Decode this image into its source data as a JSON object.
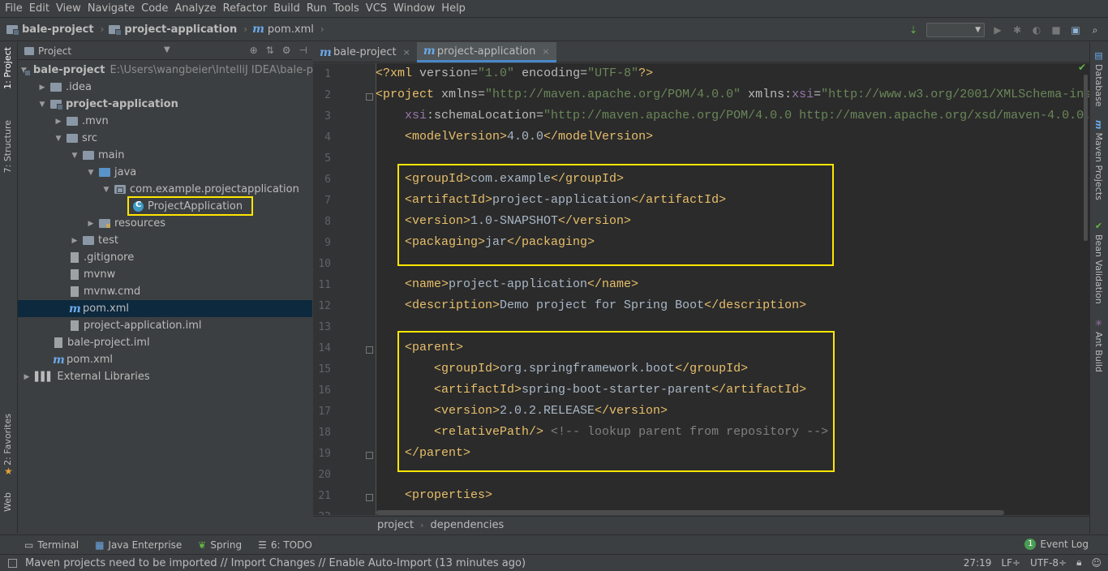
{
  "menu": [
    "File",
    "Edit",
    "View",
    "Navigate",
    "Code",
    "Analyze",
    "Refactor",
    "Build",
    "Run",
    "Tools",
    "VCS",
    "Window",
    "Help"
  ],
  "navbar": {
    "crumbs": [
      "bale-project",
      "project-application",
      "pom.xml"
    ]
  },
  "left_tabs": {
    "project": "1: Project",
    "structure": "7: Structure",
    "favorites": "2: Favorites",
    "web": "Web"
  },
  "right_tabs": {
    "database": "Database",
    "maven": "Maven Projects",
    "bean": "Bean Validation",
    "ant": "Ant Build"
  },
  "project_panel": {
    "title": "Project",
    "tree": [
      {
        "label": "bale-project",
        "path": "E:\\Users\\wangbeier\\IntelliJ IDEA\\bale-pro"
      },
      {
        "label": ".idea"
      },
      {
        "label": "project-application"
      },
      {
        "label": ".mvn"
      },
      {
        "label": "src"
      },
      {
        "label": "main"
      },
      {
        "label": "java"
      },
      {
        "label": "com.example.projectapplication"
      },
      {
        "label": "ProjectApplication"
      },
      {
        "label": "resources"
      },
      {
        "label": "test"
      },
      {
        "label": ".gitignore"
      },
      {
        "label": "mvnw"
      },
      {
        "label": "mvnw.cmd"
      },
      {
        "label": "pom.xml"
      },
      {
        "label": "project-application.iml"
      },
      {
        "label": "bale-project.iml"
      },
      {
        "label": "pom.xml"
      },
      {
        "label": "External Libraries"
      }
    ]
  },
  "editor_tabs": [
    {
      "label": "bale-project",
      "active": false
    },
    {
      "label": "project-application",
      "active": true
    }
  ],
  "editor": {
    "line_numbers": [
      "1",
      "2",
      "3",
      "4",
      "5",
      "6",
      "7",
      "8",
      "9",
      "10",
      "11",
      "12",
      "13",
      "14",
      "15",
      "16",
      "17",
      "18",
      "19",
      "20",
      "21",
      "22"
    ],
    "lines": [
      {
        "xml_decl": "<?xml",
        "v_attr": "version=",
        "v_val": "\"1.0\"",
        "e_attr": "encoding=",
        "e_val": "\"UTF-8\"",
        "end": "?>"
      },
      {
        "tag": "<project",
        "a1": "xmlns=",
        "v1": "\"http://maven.apache.org/POM/4.0.0\"",
        "a2": "xmlns:",
        "ns": "xsi",
        "a3": "=",
        "v2": "\"http://www.w3.org/2001/XMLSchema-ins"
      },
      {
        "ns": "xsi",
        "a": ":schemaLocation=",
        "v": "\"http://maven.apache.org/POM/4.0.0 http://maven.apache.org/xsd/maven-4.0.0."
      },
      {
        "open": "<modelVersion>",
        "text": "4.0.0",
        "close": "</modelVersion>"
      },
      {},
      {
        "open": "<groupId>",
        "text": "com.example",
        "close": "</groupId>"
      },
      {
        "open": "<artifactId>",
        "text": "project-application",
        "close": "</artifactId>"
      },
      {
        "open": "<version>",
        "text": "1.0-SNAPSHOT",
        "close": "</version>"
      },
      {
        "open": "<packaging>",
        "text": "jar",
        "close": "</packaging>"
      },
      {},
      {
        "open": "<name>",
        "text": "project-application",
        "close": "</name>"
      },
      {
        "open": "<description>",
        "text": "Demo project for Spring Boot",
        "close": "</description>"
      },
      {},
      {
        "open": "<parent>",
        "text": "",
        "close": ""
      },
      {
        "open": "<groupId>",
        "text": "org.springframework.boot",
        "close": "</groupId>"
      },
      {
        "open": "<artifactId>",
        "text": "spring-boot-starter-parent",
        "close": "</artifactId>"
      },
      {
        "open": "<version>",
        "text": "2.0.2.RELEASE",
        "close": "</version>"
      },
      {
        "open": "<relativePath/>",
        "comment": "<!-- lookup parent from repository -->"
      },
      {
        "open": "",
        "text": "",
        "close": "</parent>"
      },
      {},
      {
        "open": "<properties>",
        "text": "",
        "close": ""
      }
    ]
  },
  "breadcrumbs": [
    "project",
    "dependencies"
  ],
  "tool_windows": [
    "Terminal",
    "Java Enterprise",
    "Spring",
    "6: TODO"
  ],
  "event_log": {
    "badge": "1",
    "label": "Event Log"
  },
  "status": {
    "message": "Maven projects need to be imported // Import Changes // Enable Auto-Import (13 minutes ago)",
    "position": "27:19",
    "line_sep": "LF÷",
    "encoding": "UTF-8÷"
  },
  "colors": {
    "highlight": "#ffe600",
    "selection": "#0d293e",
    "tag": "#e8bf6a",
    "string": "#6a8759"
  }
}
